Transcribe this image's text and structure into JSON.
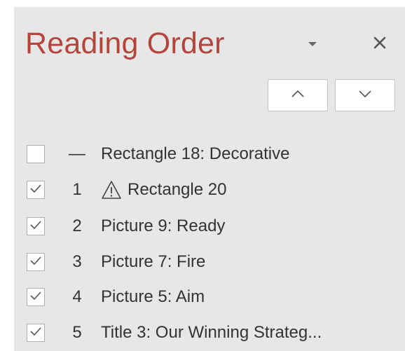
{
  "pane": {
    "title": "Reading Order",
    "dropdown_icon": "caret-down-icon",
    "close_icon": "close-x-icon",
    "move_up_icon": "chevron-up-icon",
    "move_down_icon": "chevron-down-icon"
  },
  "items": [
    {
      "checked": false,
      "order": "—",
      "warning": false,
      "label": "Rectangle 18: Decorative"
    },
    {
      "checked": true,
      "order": "1",
      "warning": true,
      "label": "Rectangle 20"
    },
    {
      "checked": true,
      "order": "2",
      "warning": false,
      "label": "Picture 9: Ready"
    },
    {
      "checked": true,
      "order": "3",
      "warning": false,
      "label": "Picture 7: Fire"
    },
    {
      "checked": true,
      "order": "4",
      "warning": false,
      "label": "Picture 5: Aim"
    },
    {
      "checked": true,
      "order": "5",
      "warning": false,
      "label": "Title 3: Our Winning Strateg..."
    }
  ],
  "colors": {
    "title": "#b5453b",
    "pane_background": "#e7e7e7",
    "text": "#333333"
  }
}
